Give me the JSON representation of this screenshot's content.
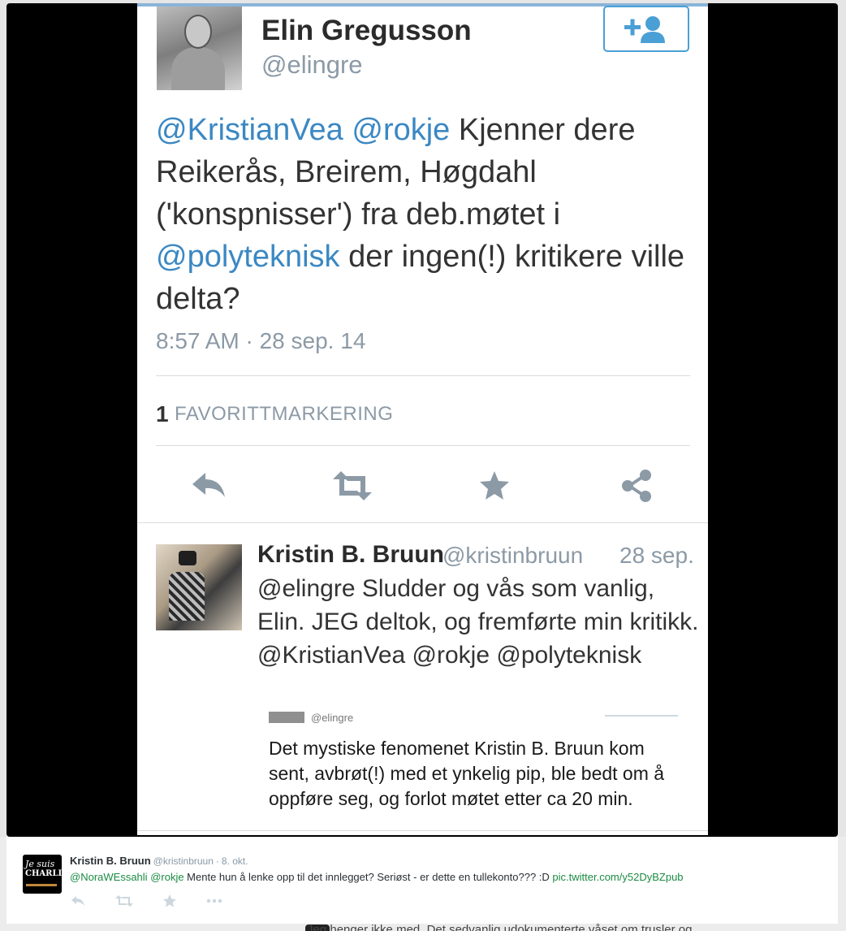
{
  "embedded_tweet": {
    "author_name": "Elin Gregusson",
    "author_handle": "@elingre",
    "text_parts": [
      {
        "text": "@KristianVea",
        "mention": true
      },
      {
        "text": " ",
        "mention": false
      },
      {
        "text": "@rokje",
        "mention": true
      },
      {
        "text": " Kjenner dere Reikerås, Breirem, Høgdahl ('konspnisser') fra deb.møtet i ",
        "mention": false
      },
      {
        "text": "@polyteknisk",
        "mention": true
      },
      {
        "text": " der ingen(!) kritikere ville delta?",
        "mention": false
      }
    ],
    "timestamp": "8:57 AM · 28 sep. 14",
    "favorite_count": "1",
    "favorite_label": "FAVORITTMARKERING",
    "actions": [
      "reply-icon",
      "retweet-icon",
      "favorite-icon",
      "share-icon"
    ]
  },
  "embedded_reply": {
    "author_name": "Kristin B. Bruun",
    "author_handle": "@kristinbruun",
    "date": "28 sep.",
    "text": "@elingre Sludder og vås som vanlig, Elin. JEG deltok, og fremførte min kritikk. @KristianVea @rokje @polyteknisk",
    "quoted": {
      "handle": "@elingre",
      "text": "Det mystiske fenomenet Kristin B. Bruun kom sent, avbrøt(!) med et ynkelig pip, ble bedt om å oppføre seg, og forlot møtet etter ca 20 min."
    }
  },
  "timeline_tweet": {
    "avatar_text_1": "Je suis",
    "avatar_text_2": "CHARLIE",
    "author_name": "Kristin B. Bruun",
    "author_handle": "@kristinbruun",
    "separator": "·",
    "date": "8. okt.",
    "mention_1": "@NoraWEssahli",
    "mention_2": "@rokje",
    "body": " Mente hun å lenke opp til det innlegget? Seriøst - er dette en tullekonto??? :D ",
    "link": "pic.twitter.com/y52DyBZpub",
    "actions": [
      "reply-icon",
      "retweet-icon",
      "favorite-icon",
      "more-icon"
    ]
  },
  "next_tweet_partial": "Jeg henger ikke med. Det sedvanlig udokumenterte våset om trusler og",
  "colors": {
    "mention_blue": "#3b88c3",
    "link_green": "#1b8b43",
    "muted_gray": "#8c9aa6",
    "follow_blue": "#4a9fd5"
  }
}
